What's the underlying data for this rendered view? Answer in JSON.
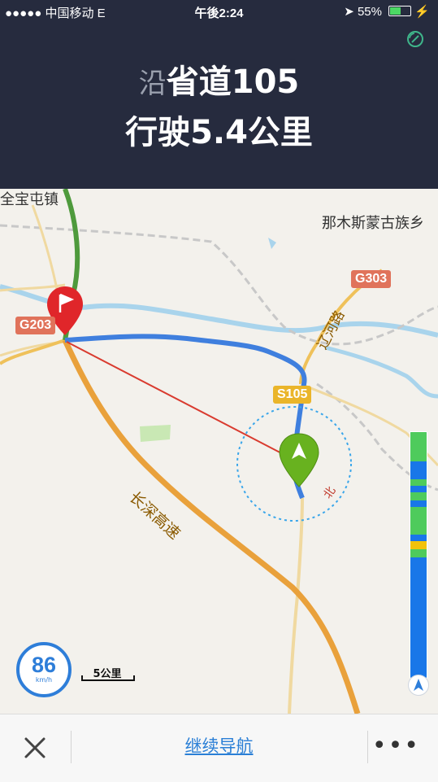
{
  "status_bar": {
    "carrier": "●●●●● 中国移动   E",
    "time": "午後2:24",
    "battery": "55%",
    "battery_level": 0.55
  },
  "navigation": {
    "prefix": "沿",
    "road": "省道105",
    "action": "行驶",
    "distance": "5.4公里"
  },
  "map": {
    "places": [
      "全宝屯镇",
      "那木斯蒙古族乡"
    ],
    "road_labels": {
      "g303": "G303",
      "g203": "G203",
      "s105": "S105",
      "liaohe_road": "辽河路",
      "changshen_expressway": "长深高速"
    },
    "compass_north": "北",
    "speed": {
      "value": "86",
      "unit": "km/h"
    },
    "scale": "5公里"
  },
  "bottom_bar": {
    "continue_label": "继续导航"
  },
  "colors": {
    "route_blue": "#3f7fde",
    "traffic_green": "#4ecb5c",
    "traffic_yellow": "#f2c20b",
    "header_bg": "#262b3e"
  }
}
